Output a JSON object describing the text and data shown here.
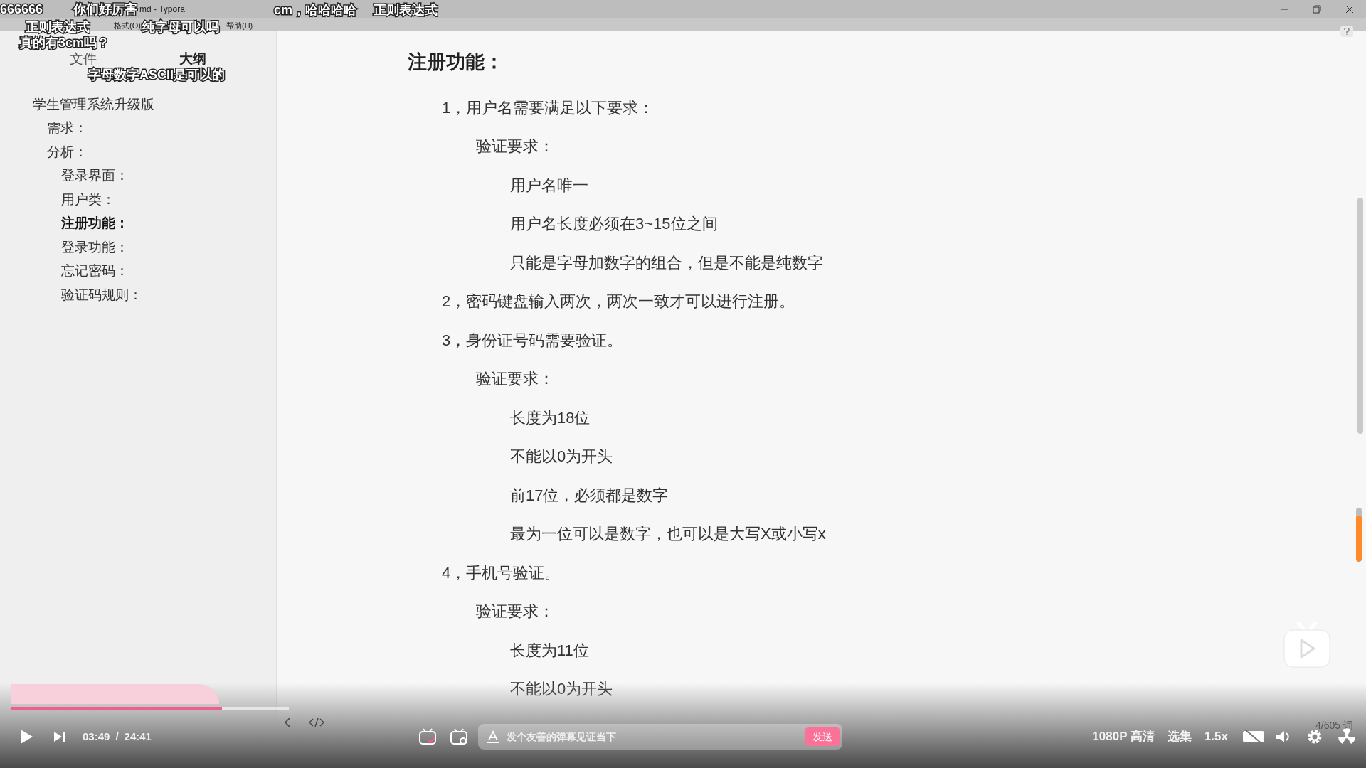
{
  "window": {
    "title": "md - Typora"
  },
  "menu": [
    "格式(O)",
    "帮助(H)"
  ],
  "sidebar": {
    "tabs": [
      {
        "label": "文件",
        "selected": false
      },
      {
        "label": "大纲",
        "selected": true
      }
    ],
    "outline": [
      {
        "label": "学生管理系统升级版",
        "selected": false,
        "children": [
          {
            "label": "需求：",
            "selected": false
          },
          {
            "label": "分析：",
            "selected": false,
            "children": [
              {
                "label": "登录界面：",
                "selected": false
              },
              {
                "label": "用户类：",
                "selected": false
              },
              {
                "label": "注册功能：",
                "selected": true
              },
              {
                "label": "登录功能：",
                "selected": false
              },
              {
                "label": "忘记密码：",
                "selected": false
              },
              {
                "label": "验证码规则：",
                "selected": false
              }
            ]
          }
        ]
      }
    ]
  },
  "document": {
    "heading": "注册功能：",
    "items": [
      {
        "text": "1，用户名需要满足以下要求：",
        "children": [
          {
            "text": "验证要求：",
            "children": [
              {
                "text": "用户名唯一"
              },
              {
                "text": "用户名长度必须在3~15位之间"
              },
              {
                "text": "只能是字母加数字的组合，但是不能是纯数字"
              }
            ]
          }
        ]
      },
      {
        "text": "2，密码键盘输入两次，两次一致才可以进行注册。"
      },
      {
        "text": "3，身份证号码需要验证。",
        "children": [
          {
            "text": "验证要求：",
            "children": [
              {
                "text": "长度为18位"
              },
              {
                "text": "不能以0为开头"
              },
              {
                "text": "前17位，必须都是数字"
              },
              {
                "text": "最为一位可以是数字，也可以是大写X或小写x"
              }
            ]
          }
        ]
      },
      {
        "text": "4，手机号验证。",
        "children": [
          {
            "text": "验证要求：",
            "children": [
              {
                "text": "长度为11位"
              },
              {
                "text": "不能以0为开头"
              }
            ]
          }
        ]
      }
    ]
  },
  "word_count": "4/605 词",
  "danmaku": [
    "666666",
    "你们好厉害",
    "cm，哈哈哈哈",
    "正则表达式",
    "正则表达式",
    "纯字母可以吗",
    "真的有3cm吗？",
    "字母数字ASCII是可以的"
  ],
  "player": {
    "progress": {
      "level": 0.76
    },
    "time": "03:49",
    "time_separator": "/",
    "duration": "24:41",
    "danmaku_placeholder": "发个友善的弹幕见证当下",
    "send": "发送",
    "quality": "1080P 高清",
    "episodes": "选集",
    "speed": "1.5x",
    "side_slider": {
      "level": 0.85
    }
  }
}
